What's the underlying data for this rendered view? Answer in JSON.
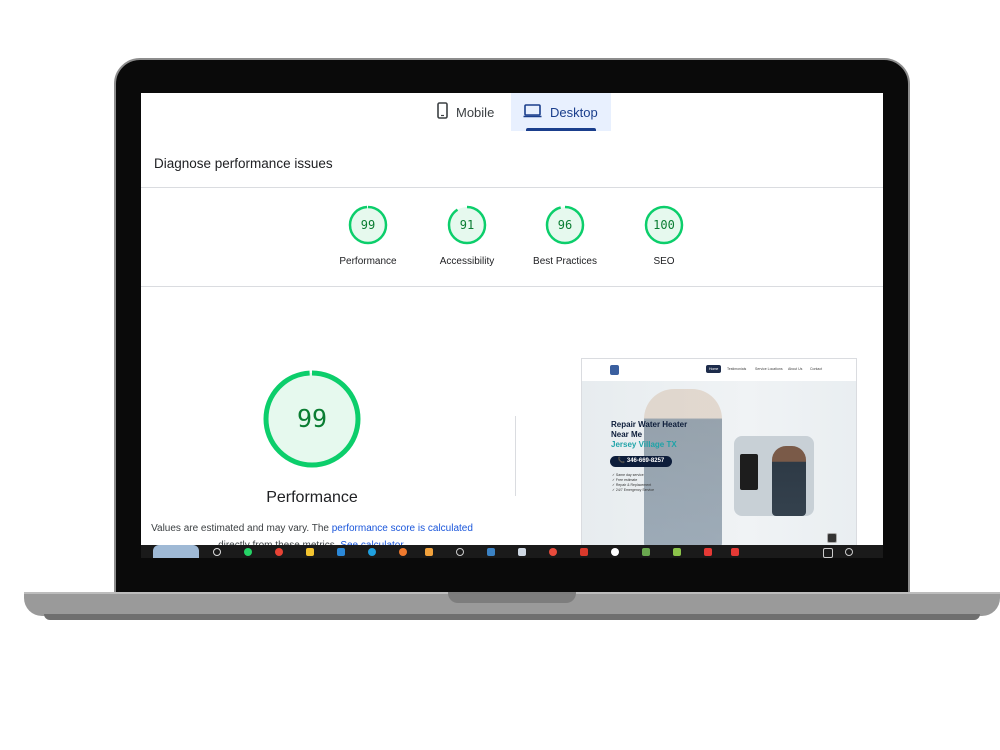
{
  "tabs": [
    {
      "label": "Mobile",
      "icon": "phone-icon",
      "selected": false
    },
    {
      "label": "Desktop",
      "icon": "laptop-icon",
      "selected": true
    }
  ],
  "section_title": "Diagnose performance issues",
  "scores": [
    {
      "value": "99",
      "label": "Performance",
      "fraction": 0.99
    },
    {
      "value": "91",
      "label": "Accessibility",
      "fraction": 0.91
    },
    {
      "value": "96",
      "label": "Best Practices",
      "fraction": 0.96
    },
    {
      "value": "100",
      "label": "SEO",
      "fraction": 1.0
    }
  ],
  "main_score": {
    "value": "99",
    "fraction": 0.99,
    "title": "Performance",
    "note_text": "Values are estimated and may vary. The ",
    "note_link": "performance score is calculated",
    "note_text2": "directly from these metrics. ",
    "note_link2": "See calculator."
  },
  "colors": {
    "pass_green": "#0cce6b",
    "pass_fill": "#e6f9ee",
    "pass_text": "#0a7d32",
    "tab_selected_bg": "#e8f0fe",
    "link": "#1a56db"
  },
  "preview": {
    "nav": [
      "Home",
      "Testimonials",
      "Service Locations",
      "About Us",
      "Contact"
    ],
    "headline": "Repair Water Heater Near Me",
    "location": "Jersey Village TX",
    "phone": "346-669-8257",
    "bullets": [
      "Same day service",
      "Free estimate",
      "Repair & Replacement",
      "24/7 Emergency Service"
    ]
  }
}
